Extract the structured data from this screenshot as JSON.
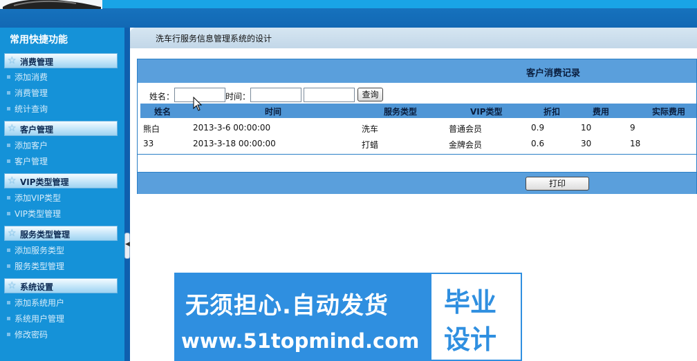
{
  "sidebar": {
    "title": "常用快捷功能",
    "groups": [
      {
        "label": "消费管理",
        "items": [
          {
            "label": "添加消费"
          },
          {
            "label": "消费管理"
          },
          {
            "label": "统计查询"
          }
        ]
      },
      {
        "label": "客户管理",
        "items": [
          {
            "label": "添加客户"
          },
          {
            "label": "客户管理"
          }
        ]
      },
      {
        "label": "VIP类型管理",
        "items": [
          {
            "label": "添加VIP类型"
          },
          {
            "label": "VIP类型管理"
          }
        ]
      },
      {
        "label": "服务类型管理",
        "items": [
          {
            "label": "添加服务类型"
          },
          {
            "label": "服务类型管理"
          }
        ]
      },
      {
        "label": "系统设置",
        "items": [
          {
            "label": "添加系统用户"
          },
          {
            "label": "系统用户管理"
          },
          {
            "label": "修改密码"
          }
        ]
      }
    ]
  },
  "breadcrumb": "洗车行服务信息管理系统的设计",
  "panel": {
    "title": "客户消费记录",
    "search": {
      "name_label": "姓名：",
      "name_value": "",
      "time_label": "时间：",
      "time_from": "",
      "time_to": "",
      "query_label": "查询"
    },
    "columns": [
      "姓名",
      "时间",
      "服务类型",
      "VIP类型",
      "折扣",
      "费用",
      "实际费用"
    ],
    "rows": [
      {
        "name": "熊白",
        "time": "2013-3-6 00:00:00",
        "service": "洗车",
        "vip": "普通会员",
        "discount": "0.9",
        "fee": "10",
        "actual": "9"
      },
      {
        "name": "33",
        "time": "2013-3-18 00:00:00",
        "service": "打蜡",
        "vip": "金牌会员",
        "discount": "0.6",
        "fee": "30",
        "actual": "18"
      }
    ],
    "print_label": "打印"
  },
  "watermark": {
    "line1": "无须担心.自动发货",
    "line2": "www.51topmind.com",
    "box_line1": "毕业",
    "box_line2": "设计"
  },
  "colors": {
    "sidebar_bg": "#1592d8",
    "page_bg": "#0f5fae",
    "panel_header": "#5a9fdc",
    "table_header": "#4f96d6",
    "watermark": "#2f8fe0"
  },
  "icons": [
    "star-icon",
    "bullet-icon",
    "collapse-arrow-icon",
    "mouse-cursor-icon",
    "car-logo-icon"
  ]
}
